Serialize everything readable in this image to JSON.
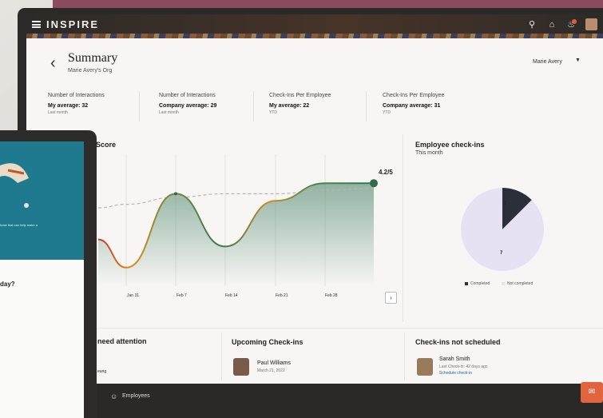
{
  "app": {
    "logo": "INSPIRE",
    "user": "Marie Avery"
  },
  "header": {
    "title": "Summary",
    "subtitle": "Marie Avery's Org"
  },
  "metrics": [
    {
      "label": "Number of Interactions",
      "value": "My average: 32",
      "period": "Last month"
    },
    {
      "label": "Number of Interactions",
      "value": "Company average: 29",
      "period": "Last month"
    },
    {
      "label": "Check-Ins Per Employee",
      "value": "My average: 22",
      "period": "YTD"
    },
    {
      "label": "Check-Ins Per Employee",
      "value": "Company average: 31",
      "period": "YTD"
    }
  ],
  "score_card": {
    "title": "Score",
    "value": "4.2",
    "suffix": "/5"
  },
  "chart_data": {
    "type": "line",
    "title": "Score",
    "categories": [
      "Jan 31",
      "Feb 7",
      "Feb 14",
      "Feb 21",
      "Feb 28"
    ],
    "series": [
      {
        "values": [
          1.8,
          3.9,
          2.4,
          3.7,
          4.2
        ]
      },
      {
        "values": [
          3.6,
          3.8,
          3.9,
          3.9,
          4.0
        ]
      }
    ],
    "last_value": 4.2
  },
  "checkins_card": {
    "title": "Employee check-ins",
    "period": "This month",
    "chart_data": {
      "type": "pie",
      "categories": [
        "Completed",
        "Not completed"
      ],
      "values": [
        1,
        7
      ],
      "colors": [
        "#2a2f3a",
        "#e7e2f3"
      ]
    }
  },
  "bottom": {
    "attention_title": "need attention",
    "attention_line": "eung",
    "upcoming_title": "Upcoming Check-ins",
    "upcoming_name": "Paul Williams",
    "upcoming_date": "March 21, 2022",
    "notsched_title": "Check-ins not scheduled",
    "notsched_name": "Sarah Smith",
    "notsched_last": "Last Check-in: 42 days ago",
    "notsched_link": "Schedule check-in"
  },
  "nav": {
    "employees": "Employees"
  },
  "tablet": {
    "hero_text": "hose that can help make a",
    "question": "day?"
  },
  "icons": {
    "search": "search-icon",
    "home": "home-icon",
    "notifications": "bell-icon",
    "chat": "chat-icon"
  }
}
